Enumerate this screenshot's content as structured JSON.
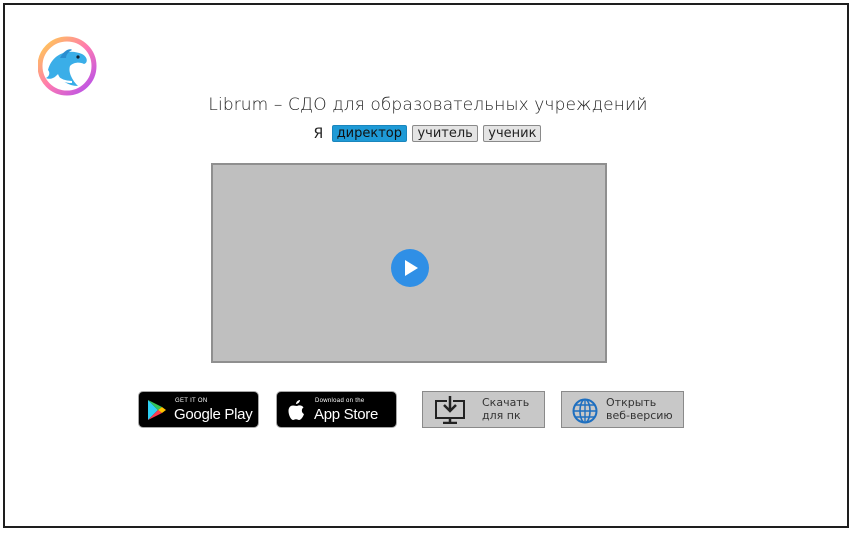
{
  "header": {
    "title": "Librum – СДО для образовательных учреждений",
    "logo_icon": "dolphin-logo-icon"
  },
  "roles": {
    "lead": "Я",
    "items": [
      {
        "label": "директор",
        "active": true
      },
      {
        "label": "учитель",
        "active": false
      },
      {
        "label": "ученик",
        "active": false
      }
    ]
  },
  "video": {
    "play_icon": "play-icon"
  },
  "stores": {
    "google_play": {
      "small": "GET IT ON",
      "big": "Google Play"
    },
    "app_store": {
      "small": "Download on the",
      "big": "App Store"
    }
  },
  "actions": {
    "download": {
      "label": "Скачать\nдля пк",
      "icon": "download-monitor-icon"
    },
    "web": {
      "label": "Открыть\nвеб-версию",
      "icon": "globe-icon"
    }
  },
  "colors": {
    "accent": "#1e9ad6",
    "play": "#2f8fe6",
    "video_bg": "#bfbfbf"
  }
}
